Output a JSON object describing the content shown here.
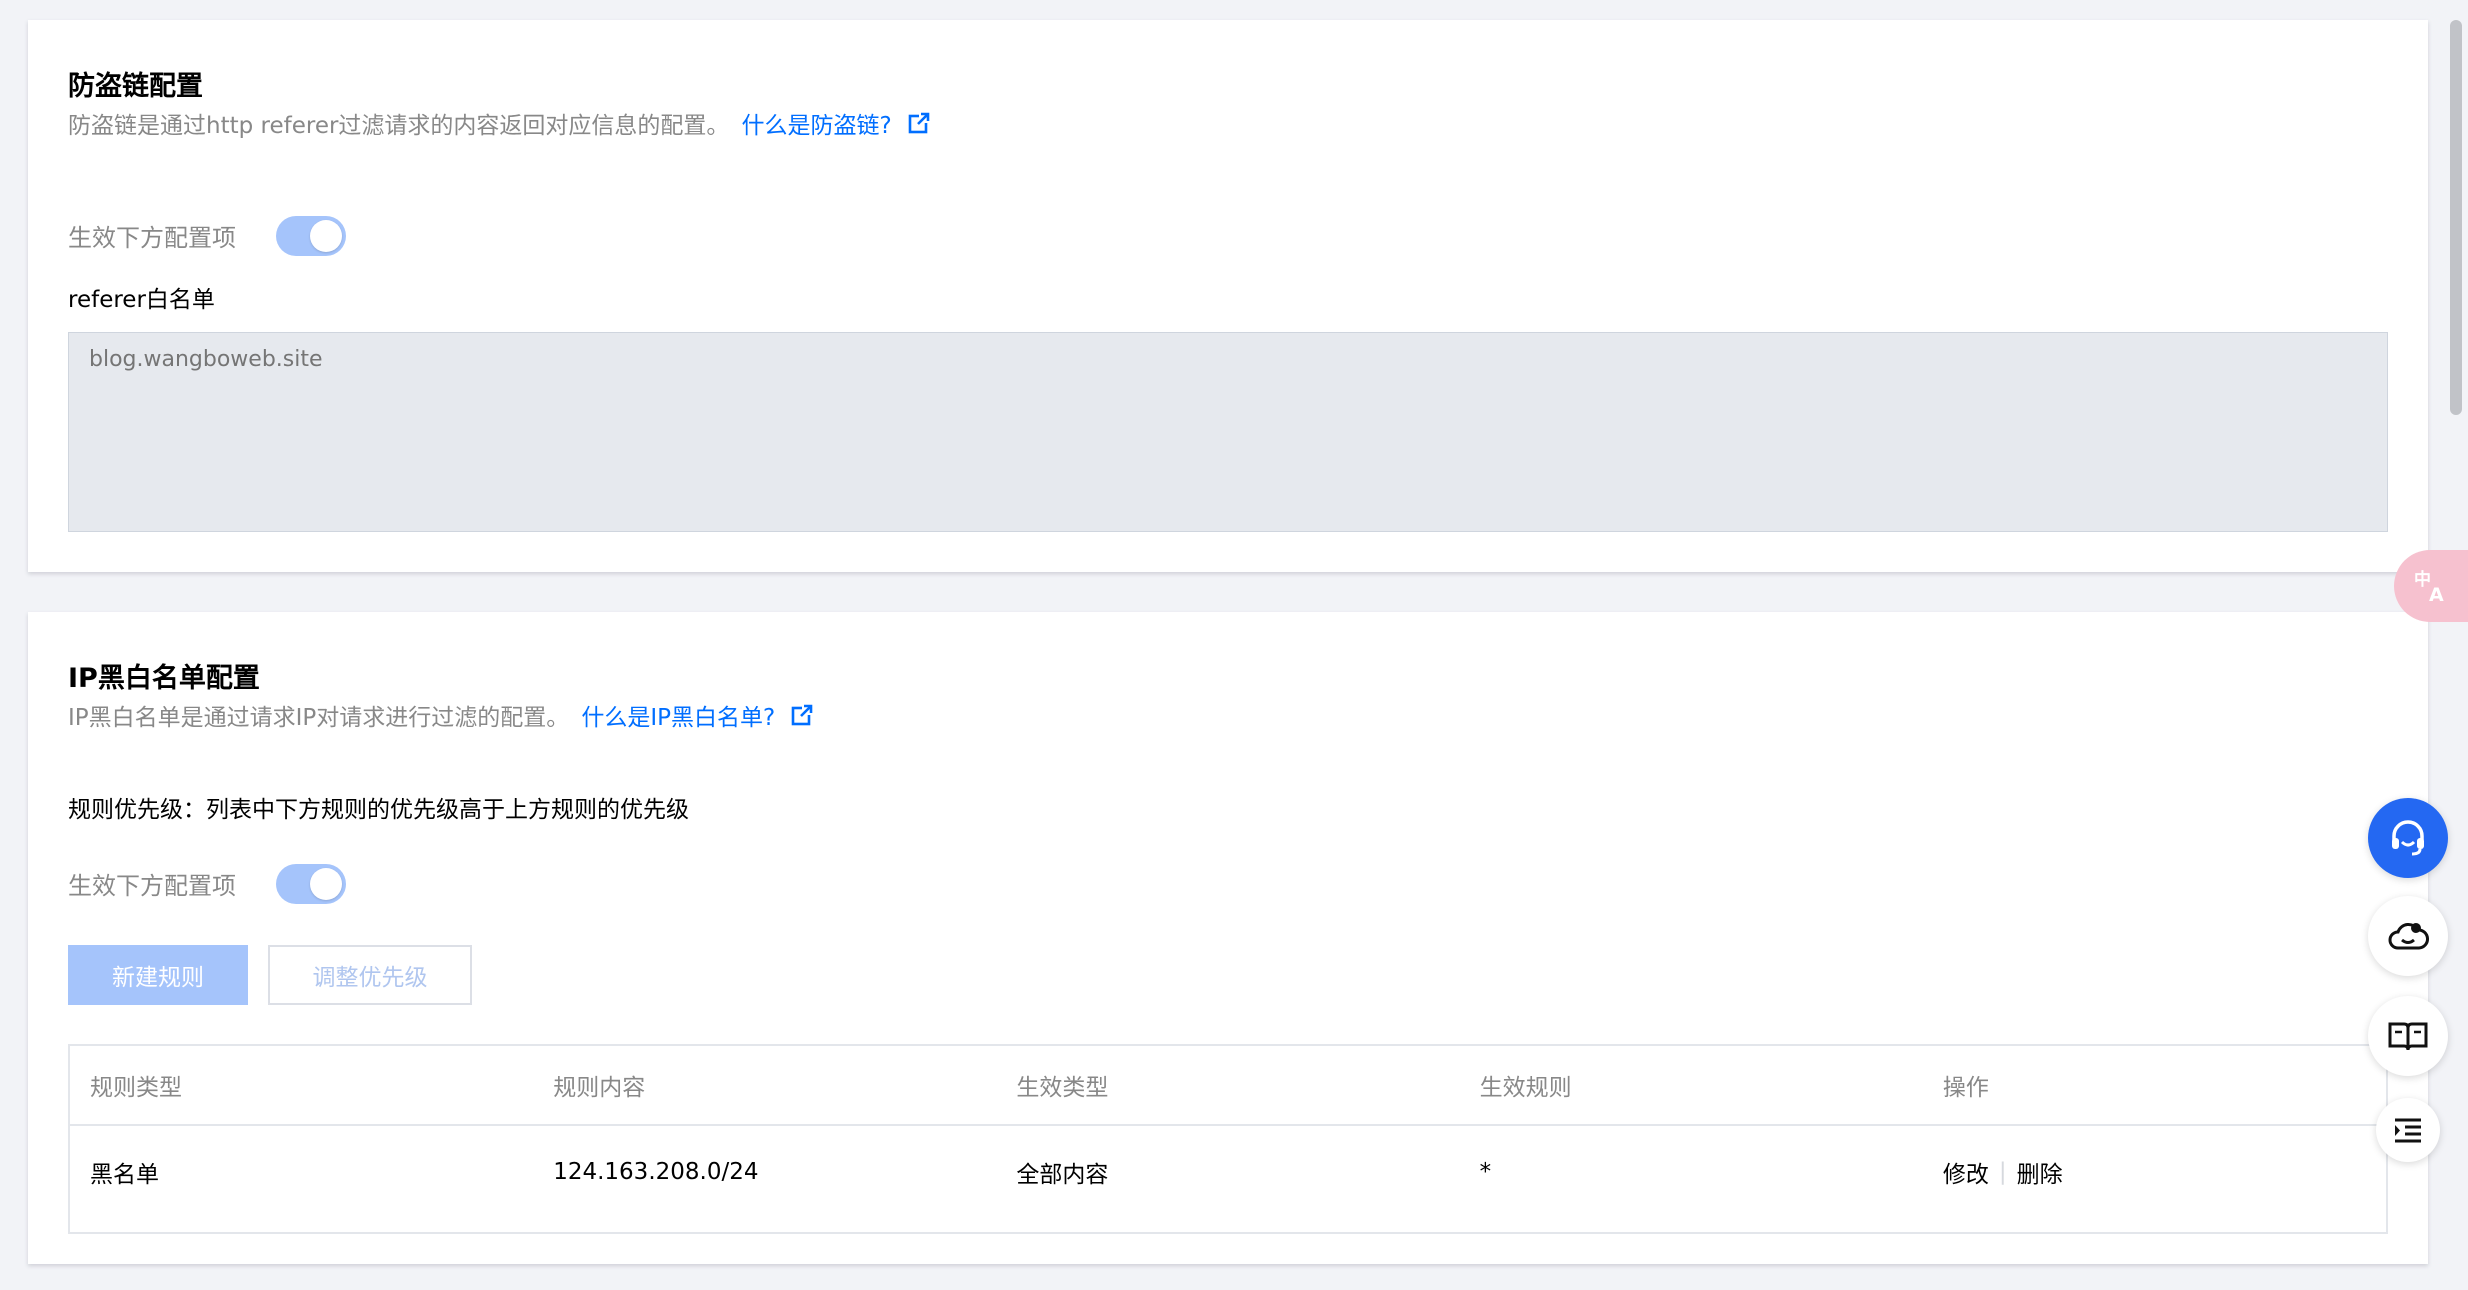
{
  "hotlink": {
    "title": "防盗链配置",
    "description": "防盗链是通过http referer过滤请求的内容返回对应信息的配置。",
    "help_link": "什么是防盗链?",
    "toggle_label": "生效下方配置项",
    "toggle_on": true,
    "whitelist_label": "referer白名单",
    "whitelist_placeholder": "blog.wangboweb.site"
  },
  "ip_config": {
    "title": "IP黑白名单配置",
    "description": "IP黑白名单是通过请求IP对请求进行过滤的配置。",
    "help_link": "什么是IP黑白名单?",
    "priority_note": "规则优先级：列表中下方规则的优先级高于上方规则的优先级",
    "toggle_label": "生效下方配置项",
    "toggle_on": true,
    "new_rule_button": "新建规则",
    "adjust_priority_button": "调整优先级",
    "table": {
      "columns": [
        "规则类型",
        "规则内容",
        "生效类型",
        "生效规则",
        "操作"
      ],
      "rows": [
        {
          "rule_type": "黑名单",
          "rule_content": "124.163.208.0/24",
          "effect_type": "全部内容",
          "effect_rule": "*",
          "edit": "修改",
          "delete": "删除"
        }
      ]
    }
  },
  "floating_tools": {
    "translate_icon": "translate-icon",
    "support_icon": "headset-icon",
    "cloud_icon": "cloud-icon",
    "docs_icon": "book-icon",
    "outline_icon": "list-indent-icon"
  },
  "colors": {
    "accent": "#006eff",
    "switch_on": "#a5c4fb",
    "fab_primary": "#2468f2"
  }
}
